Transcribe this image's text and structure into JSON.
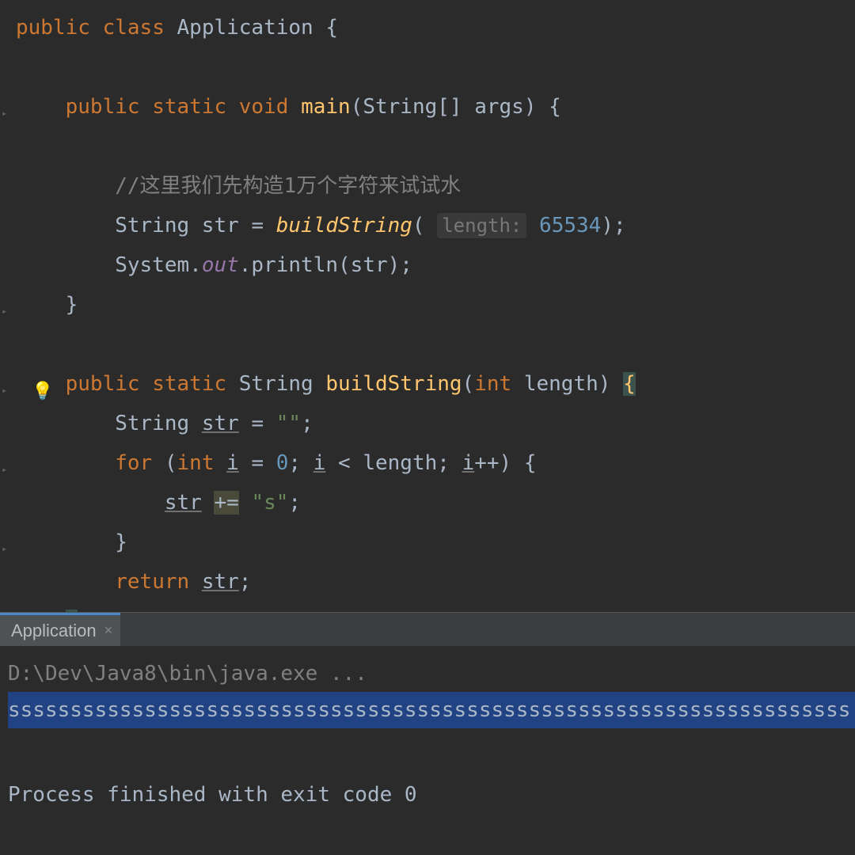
{
  "editor": {
    "lines": [
      {
        "indent": 0,
        "tokens": [
          {
            "t": "keyword",
            "v": "public"
          },
          {
            "t": "plain",
            "v": " "
          },
          {
            "t": "keyword",
            "v": "class"
          },
          {
            "t": "plain",
            "v": " Application {"
          }
        ]
      },
      {
        "indent": 0,
        "tokens": []
      },
      {
        "indent": 1,
        "tokens": [
          {
            "t": "keyword",
            "v": "public"
          },
          {
            "t": "plain",
            "v": " "
          },
          {
            "t": "keyword",
            "v": "static"
          },
          {
            "t": "plain",
            "v": " "
          },
          {
            "t": "keyword",
            "v": "void"
          },
          {
            "t": "plain",
            "v": " "
          },
          {
            "t": "method-name",
            "v": "main"
          },
          {
            "t": "plain",
            "v": "(String[] args) {"
          }
        ]
      },
      {
        "indent": 0,
        "tokens": []
      },
      {
        "indent": 2,
        "tokens": [
          {
            "t": "comment",
            "v": "//这里我们先构造1万个字符来试试水"
          }
        ]
      },
      {
        "indent": 2,
        "tokens": [
          {
            "t": "plain",
            "v": "String str = "
          },
          {
            "t": "method-call",
            "v": "buildString"
          },
          {
            "t": "plain",
            "v": "( "
          },
          {
            "t": "param-hint",
            "v": "length:"
          },
          {
            "t": "plain",
            "v": " "
          },
          {
            "t": "number",
            "v": "65534"
          },
          {
            "t": "plain",
            "v": ");"
          }
        ]
      },
      {
        "indent": 2,
        "tokens": [
          {
            "t": "plain",
            "v": "System."
          },
          {
            "t": "static-field",
            "v": "out"
          },
          {
            "t": "plain",
            "v": ".println(str);"
          }
        ]
      },
      {
        "indent": 1,
        "tokens": [
          {
            "t": "plain",
            "v": "}"
          }
        ]
      },
      {
        "indent": 0,
        "tokens": []
      },
      {
        "indent": 1,
        "tokens": [
          {
            "t": "keyword",
            "v": "public"
          },
          {
            "t": "plain",
            "v": " "
          },
          {
            "t": "keyword",
            "v": "static"
          },
          {
            "t": "plain",
            "v": " String "
          },
          {
            "t": "method-name",
            "v": "buildString"
          },
          {
            "t": "plain",
            "v": "("
          },
          {
            "t": "keyword",
            "v": "int"
          },
          {
            "t": "plain",
            "v": " length) "
          },
          {
            "t": "highlight-brace",
            "v": "{"
          }
        ]
      },
      {
        "indent": 2,
        "tokens": [
          {
            "t": "plain",
            "v": "String "
          },
          {
            "t": "underline",
            "v": "str"
          },
          {
            "t": "plain",
            "v": " = "
          },
          {
            "t": "string",
            "v": "\"\""
          },
          {
            "t": "plain",
            "v": ";"
          }
        ]
      },
      {
        "indent": 2,
        "tokens": [
          {
            "t": "keyword",
            "v": "for"
          },
          {
            "t": "plain",
            "v": " ("
          },
          {
            "t": "keyword",
            "v": "int"
          },
          {
            "t": "plain",
            "v": " "
          },
          {
            "t": "underline",
            "v": "i"
          },
          {
            "t": "plain",
            "v": " = "
          },
          {
            "t": "number",
            "v": "0"
          },
          {
            "t": "plain",
            "v": "; "
          },
          {
            "t": "underline",
            "v": "i"
          },
          {
            "t": "plain",
            "v": " < length; "
          },
          {
            "t": "underline",
            "v": "i"
          },
          {
            "t": "plain",
            "v": "++) {"
          }
        ]
      },
      {
        "indent": 3,
        "tokens": [
          {
            "t": "underline",
            "v": "str"
          },
          {
            "t": "plain",
            "v": " "
          },
          {
            "t": "highlight-op",
            "v": "+="
          },
          {
            "t": "plain",
            "v": " "
          },
          {
            "t": "string",
            "v": "\"s\""
          },
          {
            "t": "plain",
            "v": ";"
          }
        ]
      },
      {
        "indent": 2,
        "tokens": [
          {
            "t": "plain",
            "v": "}"
          }
        ]
      },
      {
        "indent": 2,
        "tokens": [
          {
            "t": "keyword",
            "v": "return"
          },
          {
            "t": "plain",
            "v": " "
          },
          {
            "t": "underline",
            "v": "str"
          },
          {
            "t": "plain",
            "v": ";"
          }
        ]
      },
      {
        "indent": 1,
        "tokens": [
          {
            "t": "highlight-brace",
            "v": "}"
          }
        ]
      }
    ],
    "bulb_line": 9
  },
  "console": {
    "tab_name": "Application",
    "path_line": "D:\\Dev\\Java8\\bin\\java.exe ...",
    "output_line": "ssssssssssssssssssssssssssssssssssssssssssssssssssssssssssssssssssss",
    "exit_line": "Process finished with exit code 0"
  }
}
